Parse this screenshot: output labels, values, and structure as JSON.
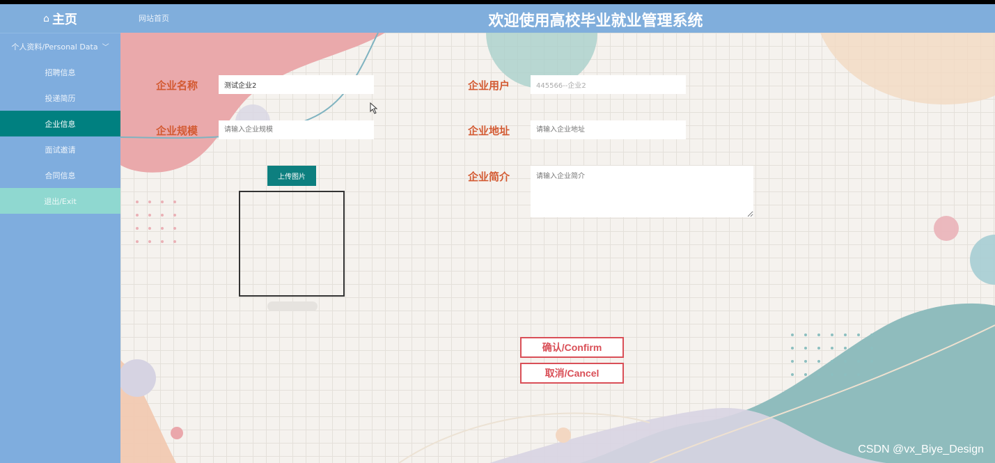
{
  "header": {
    "home_icon": "home-icon",
    "home_label": "主页",
    "site_link": "网站首页",
    "system_title": "欢迎使用高校毕业就业管理系统"
  },
  "sidebar": {
    "group_label": "个人资料/Personal Data",
    "items": [
      {
        "label": "招聘信息"
      },
      {
        "label": "投递简历"
      },
      {
        "label": "企业信息"
      },
      {
        "label": "面试邀请"
      },
      {
        "label": "合同信息"
      },
      {
        "label": "退出/Exit"
      }
    ],
    "active_index": 2
  },
  "form": {
    "company_name": {
      "label": "企业名称",
      "value": "测试企业2"
    },
    "company_user": {
      "label": "企业用户",
      "value": "445566--企业2"
    },
    "company_scale": {
      "label": "企业规模",
      "placeholder": "请输入企业规模"
    },
    "company_address": {
      "label": "企业地址",
      "placeholder": "请输入企业地址"
    },
    "company_intro": {
      "label": "企业简介",
      "placeholder": "请输入企业简介"
    },
    "upload_label": "上传图片",
    "confirm_label": "确认/Confirm",
    "cancel_label": "取消/Cancel"
  },
  "watermark": "CSDN @vx_Biye_Design",
  "colors": {
    "header": "#80aedc",
    "sidebar": "#7fadde",
    "active": "#008080",
    "exit": "#8fd8d0",
    "label": "#d35a32",
    "button_border": "#d94f57"
  }
}
